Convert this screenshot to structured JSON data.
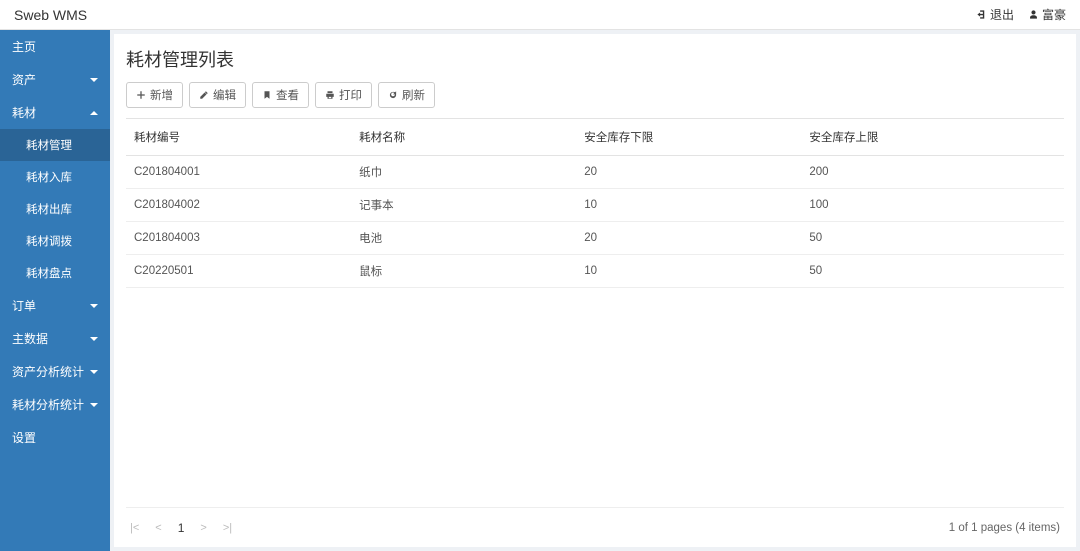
{
  "brand": "Sweb WMS",
  "header": {
    "logout": "退出",
    "user": "富豪"
  },
  "sidebar": {
    "items": [
      {
        "label": "主页",
        "caret": null
      },
      {
        "label": "资产",
        "caret": "down"
      },
      {
        "label": "耗材",
        "caret": "up",
        "subs": [
          {
            "label": "耗材管理",
            "active": true
          },
          {
            "label": "耗材入库"
          },
          {
            "label": "耗材出库"
          },
          {
            "label": "耗材调拨"
          },
          {
            "label": "耗材盘点"
          }
        ]
      },
      {
        "label": "订单",
        "caret": "down"
      },
      {
        "label": "主数据",
        "caret": "down"
      },
      {
        "label": "资产分析统计",
        "caret": "down"
      },
      {
        "label": "耗材分析统计",
        "caret": "down"
      },
      {
        "label": "设置",
        "caret": null
      }
    ]
  },
  "page": {
    "title": "耗材管理列表",
    "toolbar": {
      "add": "新增",
      "edit": "编辑",
      "view": "查看",
      "print": "打印",
      "refresh": "刷新"
    },
    "columns": {
      "code": "耗材编号",
      "name": "耗材名称",
      "min": "安全库存下限",
      "max": "安全库存上限"
    },
    "rows": [
      {
        "code": "C201804001",
        "name": "纸巾",
        "min": "20",
        "max": "200"
      },
      {
        "code": "C201804002",
        "name": "记事本",
        "min": "10",
        "max": "100"
      },
      {
        "code": "C201804003",
        "name": "电池",
        "min": "20",
        "max": "50"
      },
      {
        "code": "C20220501",
        "name": "鼠标",
        "min": "10",
        "max": "50"
      }
    ],
    "pager": {
      "current": "1",
      "summary": "1 of 1 pages (4 items)"
    }
  }
}
